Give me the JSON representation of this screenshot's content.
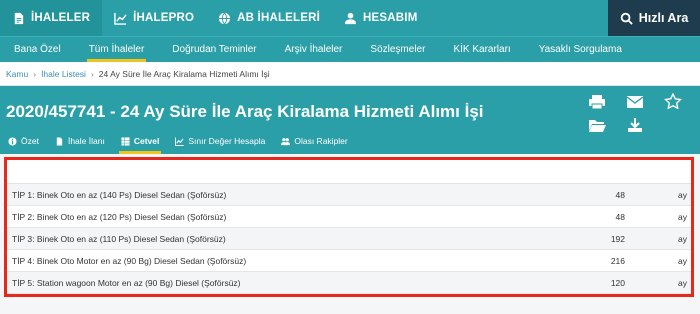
{
  "topnav": {
    "items": [
      {
        "label": "İHALELER",
        "icon": "document-icon"
      },
      {
        "label": "İHALEPRO",
        "icon": "chart-line-icon"
      },
      {
        "label": "AB İHALELERİ",
        "icon": "globe-icon"
      },
      {
        "label": "HESABIM",
        "icon": "user-icon"
      }
    ],
    "quick_search": "Hızlı Ara"
  },
  "subnav": {
    "items": [
      "Bana Özel",
      "Tüm İhaleler",
      "Doğrudan Teminler",
      "Arşiv İhaleler",
      "Sözleşmeler",
      "KİK Kararları",
      "Yasaklı Sorgulama"
    ]
  },
  "breadcrumb": {
    "items": [
      "Kamu",
      "İhale Listesi",
      "24 Ay Süre İle Araç Kiralama Hizmeti Alımı İşi"
    ]
  },
  "page": {
    "title": "2020/457741 - 24 Ay Süre İle Araç Kiralama Hizmeti Alımı İşi"
  },
  "tabs": [
    {
      "label": "Özet",
      "icon": "info-icon"
    },
    {
      "label": "İhale İlanı",
      "icon": "document-icon"
    },
    {
      "label": "Cetvel",
      "icon": "grid-icon"
    },
    {
      "label": "Sınır Değer Hesapla",
      "icon": "chart-line-icon"
    },
    {
      "label": "Olası Rakipler",
      "icon": "users-icon"
    }
  ],
  "table": {
    "rows": [
      {
        "name": "TİP 1: Binek Oto en az (140 Ps) Diesel Sedan (Şoförsüz)",
        "qty": "48",
        "unit": "ay"
      },
      {
        "name": "TİP 2: Binek Oto en az (120 Ps) Diesel Sedan (Şoförsüz)",
        "qty": "48",
        "unit": "ay"
      },
      {
        "name": "TİP 3: Binek Oto en az (110 Ps) Diesel Sedan (Şoförsüz)",
        "qty": "192",
        "unit": "ay"
      },
      {
        "name": "TİP 4: Binek Oto Motor en az (90 Bg) Diesel Sedan (Şoförsüz)",
        "qty": "216",
        "unit": "ay"
      },
      {
        "name": "TİP 5: Station wagoon Motor en az (90 Bg) Diesel (Şoförsüz)",
        "qty": "120",
        "unit": "ay"
      }
    ]
  },
  "colors": {
    "primary": "#2a9fa8",
    "dark": "#1f3c4e",
    "accent": "#f0c419",
    "highlight": "#e8281c"
  }
}
